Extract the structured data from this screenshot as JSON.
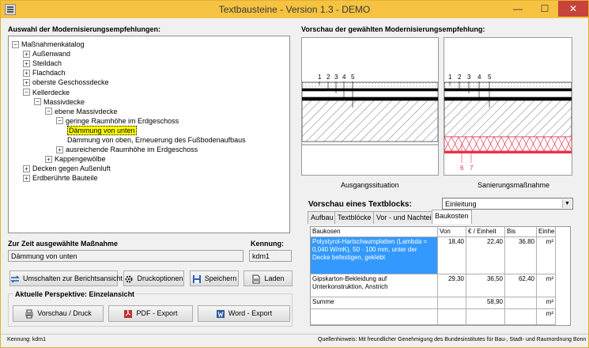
{
  "window": {
    "title": "Textbausteine - Version 1.3 - DEMO",
    "minimize": "—",
    "maximize": "☐",
    "close": "✕"
  },
  "left": {
    "tree_heading": "Auswahl der Modernisierungsempfehlungen:",
    "tree": [
      {
        "label": "Maßnahmenkatalog",
        "level": 0,
        "exp": "−"
      },
      {
        "label": "Außenwand",
        "level": 1,
        "exp": "+"
      },
      {
        "label": "Steildach",
        "level": 1,
        "exp": "+"
      },
      {
        "label": "Flachdach",
        "level": 1,
        "exp": "+"
      },
      {
        "label": "oberste Geschossdecke",
        "level": 1,
        "exp": "+"
      },
      {
        "label": "Kellerdecke",
        "level": 1,
        "exp": "−"
      },
      {
        "label": "Massivdecke",
        "level": 2,
        "exp": "−"
      },
      {
        "label": "ebene Massivdecke",
        "level": 3,
        "exp": "−"
      },
      {
        "label": "geringe Raumhöhe im Erdgeschoss",
        "level": 4,
        "exp": "−"
      },
      {
        "label": "Dämmung von unten",
        "level": 5,
        "exp": "",
        "selected": true
      },
      {
        "label": "Dämmung von oben, Erneuerung des Fußbodenaufbaus",
        "level": 5,
        "exp": ""
      },
      {
        "label": "ausreichende Raumhöhe im Erdgeschoss",
        "level": 4,
        "exp": "+"
      },
      {
        "label": "Kappengewölbe",
        "level": 3,
        "exp": "+"
      },
      {
        "label": "Decken gegen Außenluft",
        "level": 1,
        "exp": "+"
      },
      {
        "label": "Erdberührte Bauteile",
        "level": 1,
        "exp": "+"
      }
    ],
    "selected_label": "Zur Zeit ausgewählte Maßnahme",
    "selected_value": "Dämmung von unten",
    "code_label": "Kennung:",
    "code_value": "kdm1",
    "buttons": {
      "switch": "Umschalten zur Berichtsansicht",
      "print_options": "Druckoptionen",
      "save": "Speichern",
      "load": "Laden"
    },
    "perspective_label": "Aktuelle Perspektive: Einzelansicht",
    "export_buttons": {
      "preview": "Vorschau / Druck",
      "pdf": "PDF - Export",
      "word": "Word - Export"
    }
  },
  "right": {
    "preview_heading": "Vorschau der gewählten Modernisierungsempfehlung:",
    "caption_before": "Ausgangssituation",
    "caption_after": "Sanierungsmaßnahme",
    "layer_numbers": [
      "1",
      "2",
      "3",
      "4",
      "5"
    ],
    "layer_numbers_after": [
      "6",
      "7"
    ],
    "textblock_label": "Vorschau eines Textblocks:",
    "combo_value": "Einleitung",
    "tabs": [
      "Aufbau",
      "Textblöcke",
      "Vor - und Nachteile",
      "Baukosten"
    ],
    "active_tab": 3,
    "table": {
      "headers": [
        "Baukosen",
        "Von",
        "€ / Einheit",
        "Bis",
        "Einheit"
      ],
      "rows": [
        [
          "Polystyrol-Hartschaumplatten (Lambda = 0,040 W/mK), 50 - 100 mm, unter der Decke befestigen, geklebt",
          "18,40",
          "22,40",
          "36,80",
          "m²"
        ],
        [
          "Gipskarton-Bekleidung auf Unterkonstruktion, Anstrich",
          "29,30",
          "36,50",
          "62,40",
          "m²"
        ],
        [
          "Summe",
          "",
          "58,90",
          "",
          "m²"
        ],
        [
          "",
          "",
          "",
          "",
          "m²"
        ]
      ]
    }
  },
  "status": {
    "left": "Kennung: kdm1",
    "right": "Quellenhinweis: Mit freundlicher Genehmigung des Bundesinstitutes für Bau-, Stadt- und Raumordnung Bonn"
  },
  "colors": {
    "titlebar": "#f5c242",
    "selection": "#ffff00",
    "row_highlight": "#3399ff",
    "insulation": "#e8324a"
  }
}
